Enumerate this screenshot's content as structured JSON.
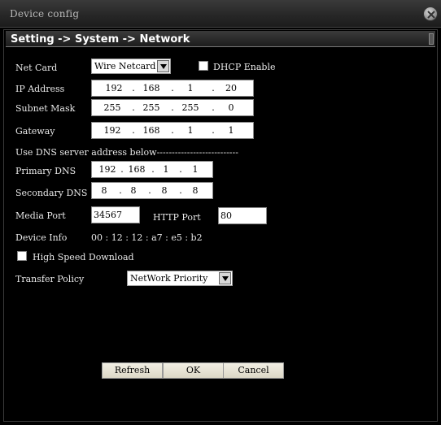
{
  "window": {
    "title": "Device config",
    "close_icon": "close-icon"
  },
  "breadcrumb": "Setting -> System -> Network",
  "net_card": {
    "label": "Net Card",
    "value": "Wire Netcard"
  },
  "dhcp": {
    "label": "DHCP Enable",
    "checked": false
  },
  "ip_address": {
    "label": "IP Address",
    "octets": [
      "192",
      "168",
      "1",
      "20"
    ]
  },
  "subnet_mask": {
    "label": "Subnet Mask",
    "octets": [
      "255",
      "255",
      "255",
      "0"
    ]
  },
  "gateway": {
    "label": "Gateway",
    "octets": [
      "192",
      "168",
      "1",
      "1"
    ]
  },
  "dns_heading": "Use DNS server address below---------------------------",
  "primary_dns": {
    "label": "Primary DNS",
    "octets": [
      "192",
      "168",
      "1",
      "1"
    ]
  },
  "secondary_dns": {
    "label": "Secondary DNS",
    "octets": [
      "8",
      "8",
      "8",
      "8"
    ]
  },
  "media_port": {
    "label": "Media Port",
    "value": "34567"
  },
  "http_port": {
    "label": "HTTP Port",
    "value": "80"
  },
  "device_info": {
    "label": "Device Info",
    "value": "00 : 12 : 12 : a7 : e5 : b2"
  },
  "high_speed": {
    "label": "High Speed Download",
    "checked": false
  },
  "transfer_policy": {
    "label": "Transfer Policy",
    "value": "NetWork  Priority"
  },
  "buttons": {
    "refresh": "Refresh",
    "ok": "OK",
    "cancel": "Cancel"
  }
}
